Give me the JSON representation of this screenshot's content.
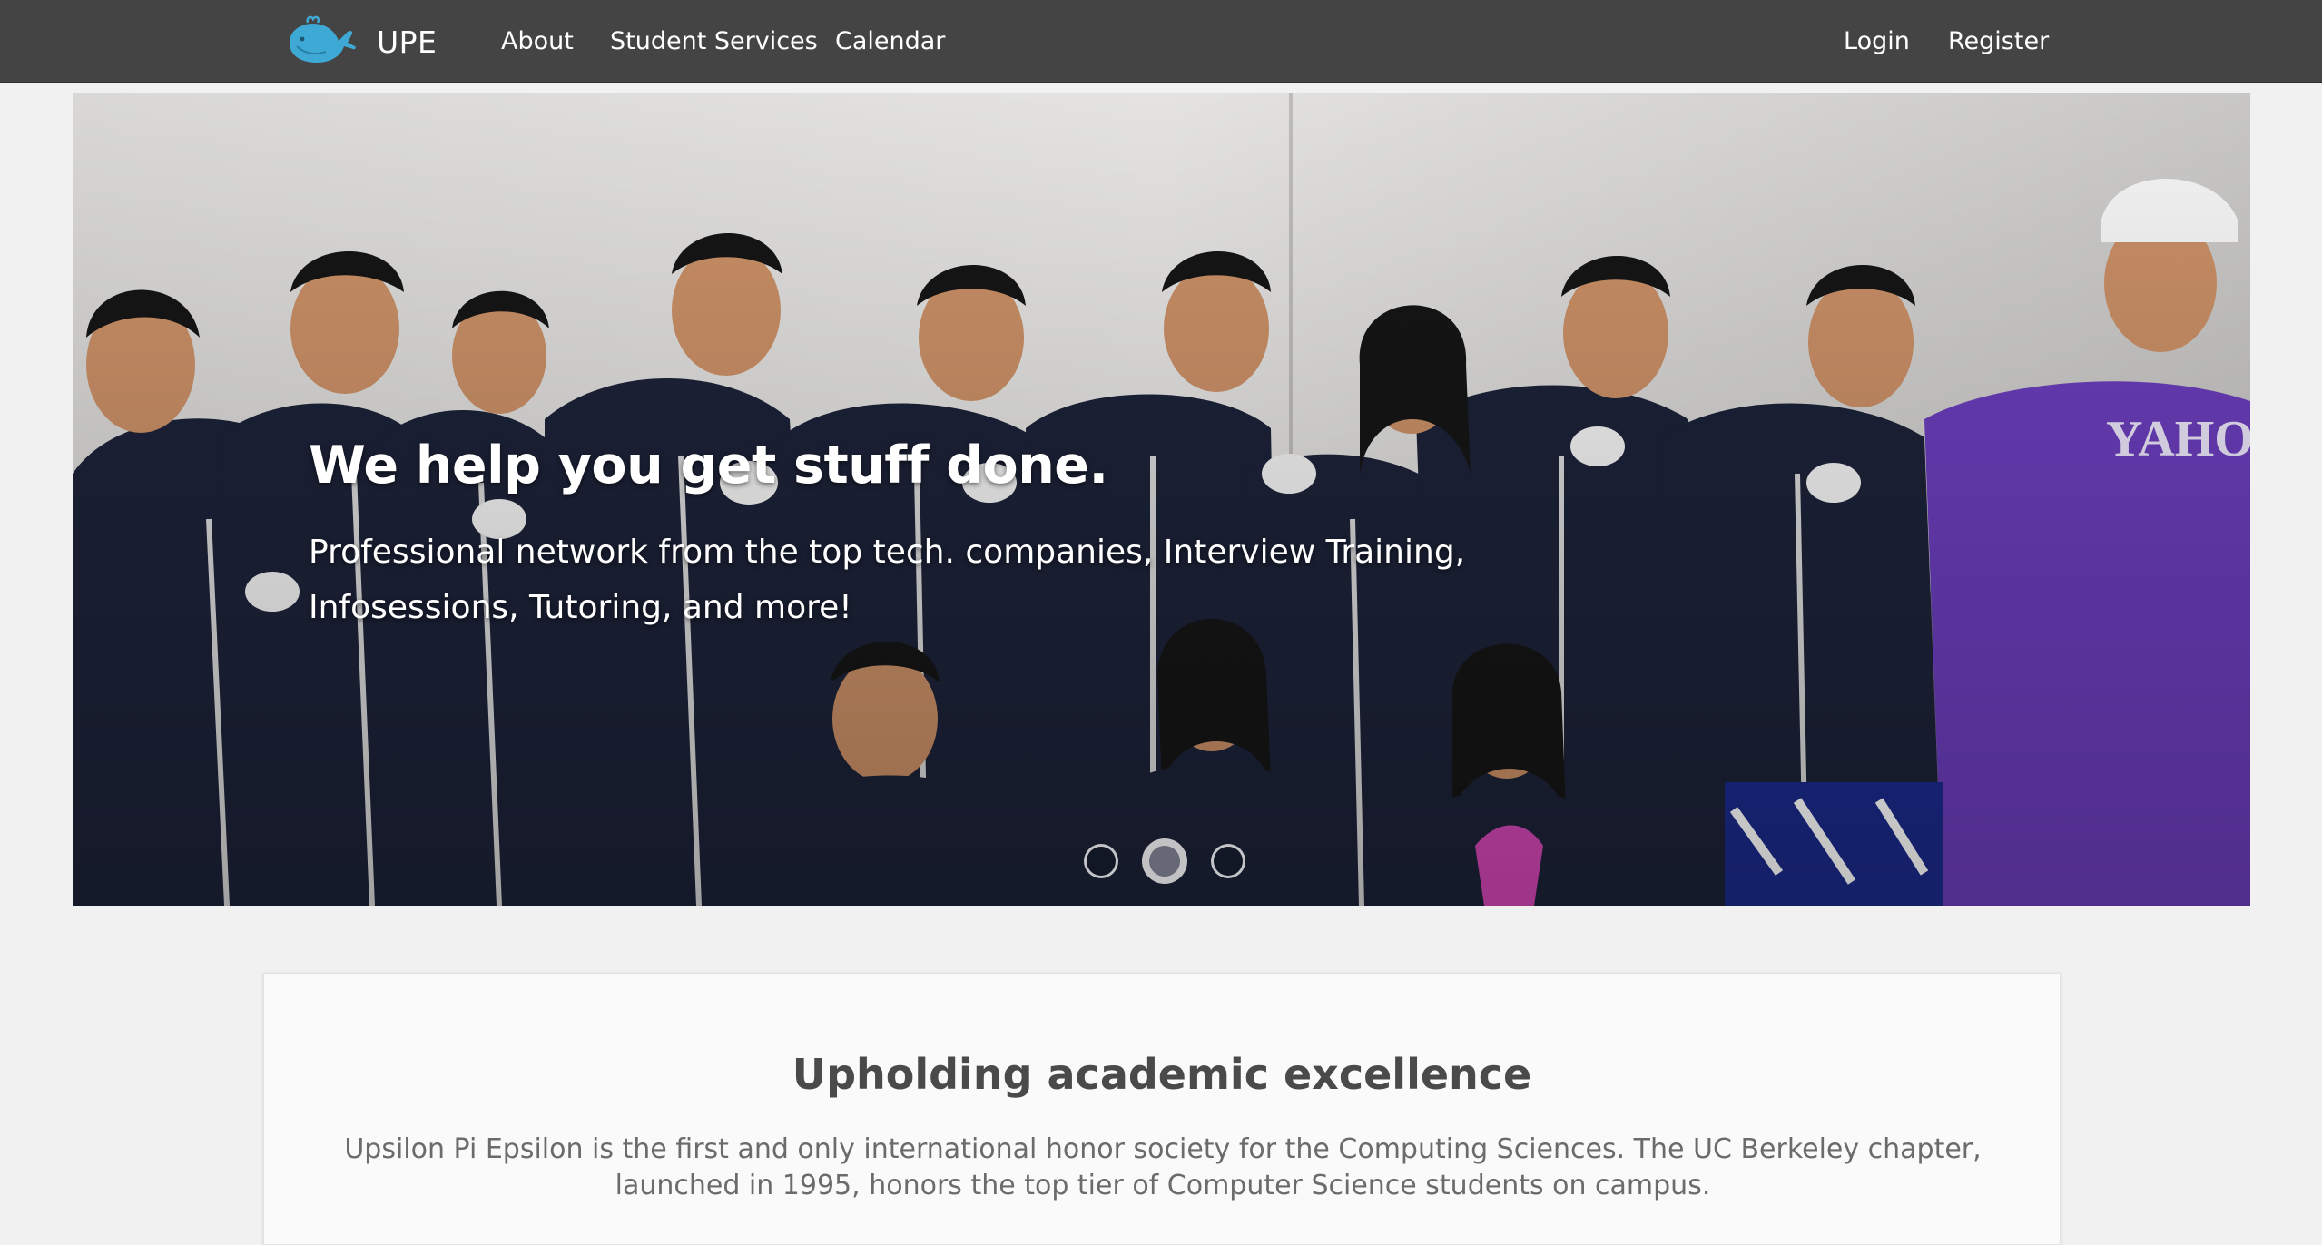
{
  "navbar": {
    "brand_icon": "whale-logo-icon",
    "brand_text": "UPE",
    "links": [
      "About",
      "Student Services",
      "Calendar"
    ],
    "auth": {
      "login": "Login",
      "register": "Register"
    },
    "background": "#444444"
  },
  "hero": {
    "title": "We help you get stuff done.",
    "subtitle": "Professional network from the top tech. companies, Interview Training, Infosessions, Tutoring, and more!",
    "slide_count": 3,
    "active_slide": 2
  },
  "intro": {
    "title": "Upholding academic excellence",
    "text": "Upsilon Pi Epsilon is the first and only international honor society for the Computing Sciences. The UC Berkeley chapter, launched in 1995, honors the top tier of Computer Science students on campus."
  },
  "colors": {
    "brand_blue": "#3fa9d6",
    "navbar": "#444444",
    "page_bg": "#f1f1f1"
  }
}
